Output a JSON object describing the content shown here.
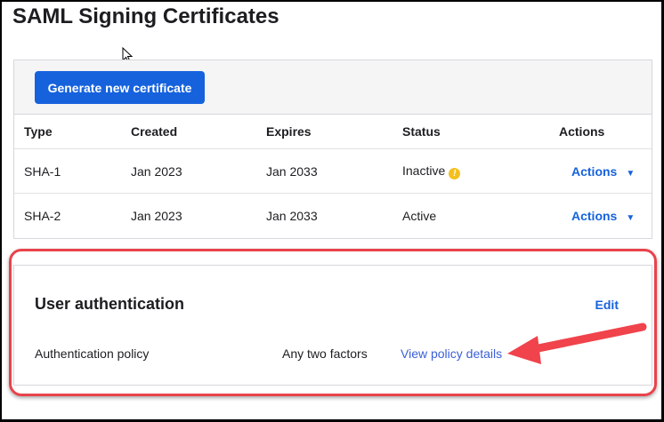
{
  "page_title": "SAML Signing Certificates",
  "generate_button": "Generate new certificate",
  "table": {
    "headers": [
      "Type",
      "Created",
      "Expires",
      "Status",
      "Actions"
    ],
    "rows": [
      {
        "type": "SHA-1",
        "created": "Jan 2023",
        "expires": "Jan 2033",
        "status": "Inactive",
        "warning": true,
        "action": "Actions"
      },
      {
        "type": "SHA-2",
        "created": "Jan 2023",
        "expires": "Jan 2033",
        "status": "Active",
        "warning": false,
        "action": "Actions"
      }
    ]
  },
  "user_auth": {
    "title": "User authentication",
    "edit": "Edit",
    "policy_label": "Authentication policy",
    "policy_value": "Any two factors",
    "policy_link": "View policy details"
  },
  "colors": {
    "accent": "#1662dd",
    "highlight": "#e8434b",
    "warning": "#f4c01e"
  }
}
